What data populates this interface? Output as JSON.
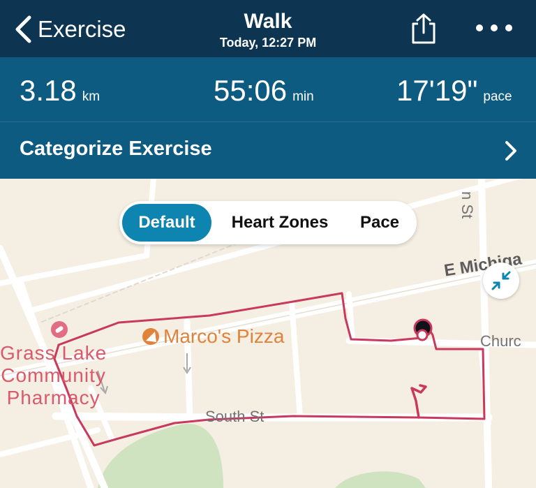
{
  "header": {
    "back_label": "Exercise",
    "title": "Walk",
    "subtitle": "Today, 12:27 PM",
    "share_icon": "share-icon",
    "more_icon": "more-options-icon"
  },
  "stats": {
    "distance": {
      "value": "3.18",
      "unit": "km"
    },
    "duration": {
      "value": "55:06",
      "unit": "min"
    },
    "pace": {
      "value": "17'19\"",
      "unit": "pace"
    }
  },
  "categorize": {
    "label": "Categorize Exercise"
  },
  "map": {
    "tabs": [
      {
        "label": "Default",
        "active": true
      },
      {
        "label": "Heart Zones",
        "active": false
      },
      {
        "label": "Pace",
        "active": false
      }
    ],
    "labels": {
      "pharmacy_line1": "Grass Lake",
      "pharmacy_line2": "Community",
      "pharmacy_line3": "Pharmacy",
      "pizza": "Marco's Pizza",
      "south_st": "South St",
      "e_michigan": "E Michiga",
      "church": "Churc",
      "n_st": "n St"
    },
    "route_color": "#c8395d",
    "collapse_icon": "collapse-arrows-icon"
  },
  "colors": {
    "header_bg": "#0d3551",
    "stats_bg": "#0e5b81",
    "accent": "#0e84b0",
    "map_bg": "#f5efe3"
  }
}
